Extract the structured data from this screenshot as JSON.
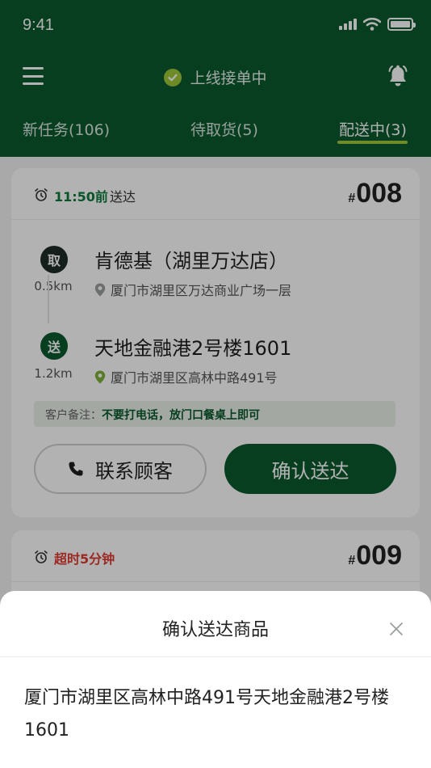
{
  "status_bar": {
    "time": "9:41"
  },
  "topbar": {
    "online_status": "上线接单中"
  },
  "tabs": [
    {
      "label": "新任务(106)",
      "active": false
    },
    {
      "label": "待取货(5)",
      "active": false
    },
    {
      "label": "配送中(3)",
      "active": true
    }
  ],
  "orders": [
    {
      "deadline": "11:50前",
      "deadline_suffix": "送达",
      "hash": "#",
      "number": "008",
      "pickup": {
        "badge": "取",
        "distance": "0.5km",
        "name": "肯德基（湖里万达店）",
        "address": "厦门市湖里区万达商业广场一层"
      },
      "dropoff": {
        "badge": "送",
        "distance": "1.2km",
        "name": "天地金融港2号楼1601",
        "address": "厦门市湖里区高林中路491号"
      },
      "note_label": "客户备注：",
      "note_text": "不要打电话，放门口餐桌上即可",
      "contact_label": "联系顾客",
      "confirm_label": "确认送达"
    },
    {
      "status": "超时5分钟",
      "hash": "#",
      "number": "009"
    }
  ],
  "sheet": {
    "title": "确认送达商品",
    "address": "厦门市湖里区高林中路491号天地金融港2号楼1601"
  },
  "colors": {
    "brand_green": "#0b5a2e",
    "accent_lime": "#9ec83a",
    "deadline_green": "#0b7a3a",
    "overdue_red": "#e03a32"
  }
}
